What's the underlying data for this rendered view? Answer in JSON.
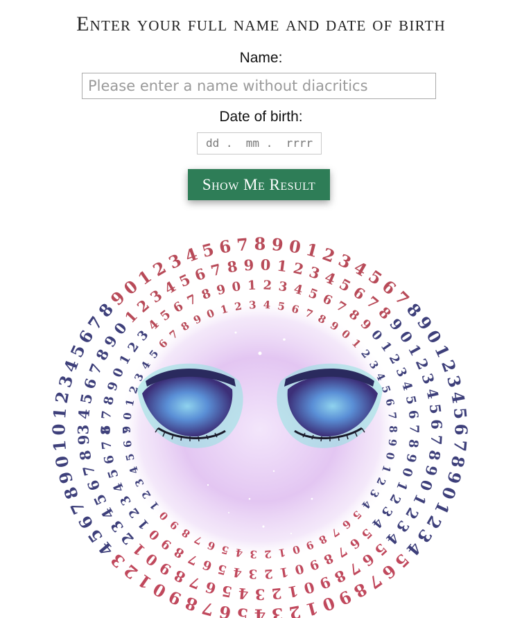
{
  "heading": "Enter your full name and date of birth",
  "form": {
    "name_label": "Name:",
    "name_placeholder": "Please enter a name without diacritics",
    "dob_label": "Date of birth:",
    "dob_placeholder": "dd .  mm .  rrrr",
    "submit_label": "Show Me Result"
  },
  "illustration": {
    "digits": "0123456789",
    "colors": {
      "numbers_top": "#b84a58",
      "numbers_side": "#3d3f7a",
      "numbers_bottom": "#c0485c",
      "glow": "#e3c6f2",
      "eyeshadow": "#5a8fd6",
      "brow": "#2a2a5e"
    }
  },
  "colors": {
    "button_bg": "#2e7d57",
    "button_text": "#ffffff"
  }
}
